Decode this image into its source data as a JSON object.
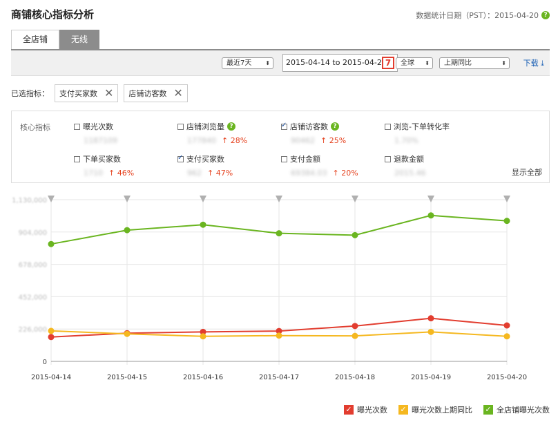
{
  "header": {
    "title": "商铺核心指标分析",
    "stat_date": "数据统计日期（PST）：2015-04-20"
  },
  "tabs": [
    {
      "label": "全店铺",
      "active": false
    },
    {
      "label": "无线",
      "active": true
    }
  ],
  "toolbar": {
    "period": "最近7天",
    "date_range": "2015-04-14 to 2015-04-20",
    "calendar_day": "7",
    "region": "全球",
    "compare": "上期同比",
    "download": "下载"
  },
  "selected": {
    "label": "已选指标：",
    "chips": [
      "支付买家数",
      "店铺访客数"
    ]
  },
  "metrics": {
    "label": "核心指标",
    "items": [
      {
        "name": "曝光次数",
        "value": "1187109",
        "change": "",
        "checked": false
      },
      {
        "name": "店铺浏览量",
        "value": "177840",
        "change": "28%",
        "checked": false,
        "help": true
      },
      {
        "name": "店铺访客数",
        "value": "90462",
        "change": "25%",
        "checked": true,
        "help": true
      },
      {
        "name": "浏览-下单转化率",
        "value": "1.70%",
        "change": "",
        "checked": false
      },
      {
        "name": "下单买家数",
        "value": "1710",
        "change": "46%",
        "checked": false
      },
      {
        "name": "支付买家数",
        "value": "962",
        "change": "47%",
        "checked": true
      },
      {
        "name": "支付金额",
        "value": "69384.03",
        "change": "20%",
        "checked": false
      },
      {
        "name": "退款金额",
        "value": "2015.46",
        "change": "",
        "checked": false
      }
    ],
    "show_all": "显示全部"
  },
  "colors": {
    "red": "#e23d2f",
    "yellow": "#f5b820",
    "green": "#6ab520"
  },
  "chart_data": {
    "type": "line",
    "categories": [
      "2015-04-14",
      "2015-04-15",
      "2015-04-16",
      "2015-04-17",
      "2015-04-18",
      "2015-04-19",
      "2015-04-20"
    ],
    "ylim": [
      0,
      1130000
    ],
    "yticks": [
      {
        "value": 0,
        "label": "0"
      },
      {
        "value": 226000,
        "label": "226,000"
      },
      {
        "value": 452000,
        "label": "452,000"
      },
      {
        "value": 678000,
        "label": "678,000"
      },
      {
        "value": 904000,
        "label": "904,000"
      },
      {
        "value": 1130000,
        "label": "1,130,000"
      }
    ],
    "series": [
      {
        "name": "曝光次数",
        "color": "#e23d2f",
        "values": [
          170000,
          197000,
          206000,
          212000,
          247000,
          301000,
          251000
        ]
      },
      {
        "name": "曝光次数上期同比",
        "color": "#f5b820",
        "values": [
          213000,
          192000,
          175000,
          180000,
          178000,
          206000,
          175000
        ]
      },
      {
        "name": "全店铺曝光次数",
        "color": "#6ab520",
        "values": [
          820000,
          917000,
          955000,
          895000,
          882000,
          1020000,
          982000
        ]
      }
    ],
    "grid": true,
    "legend_position": "bottom-right"
  }
}
